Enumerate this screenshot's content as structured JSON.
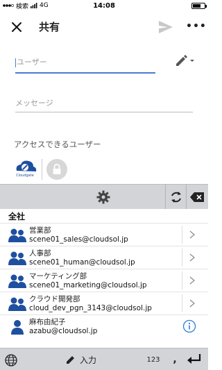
{
  "status_bar": {
    "carrier_label": "検索",
    "network": "4G",
    "time": "14:08"
  },
  "header": {
    "title": "共有",
    "more_label": "•••"
  },
  "form": {
    "user_placeholder": "ユーザー",
    "message_placeholder": "メッセージ"
  },
  "access": {
    "title": "アクセスできるユーザー",
    "avatar_text": "Cloudgate"
  },
  "directory": {
    "section_label": "全社",
    "rows": [
      {
        "name": "営業部",
        "email": "scene01_sales@cloudsol.jp",
        "type": "group"
      },
      {
        "name": "人事部",
        "email": "scene01_human@cloudsol.jp",
        "type": "group"
      },
      {
        "name": "マーケティング部",
        "email": "scene01_marketing@cloudsol.jp",
        "type": "group"
      },
      {
        "name": "クラウド開発部",
        "email": "cloud_dev_pgn_3143@cloudsol.jp",
        "type": "group"
      },
      {
        "name": "麻布由紀子",
        "email": "azabu@cloudsol.jp",
        "type": "person"
      }
    ]
  },
  "keyboard": {
    "input_label": "入力",
    "numbers_label": "123",
    "comma_label": ","
  },
  "colors": {
    "accent": "#4a7bd1",
    "icon_blue": "#1f4fa0",
    "keyboard_bg": "#d2d4d8"
  }
}
